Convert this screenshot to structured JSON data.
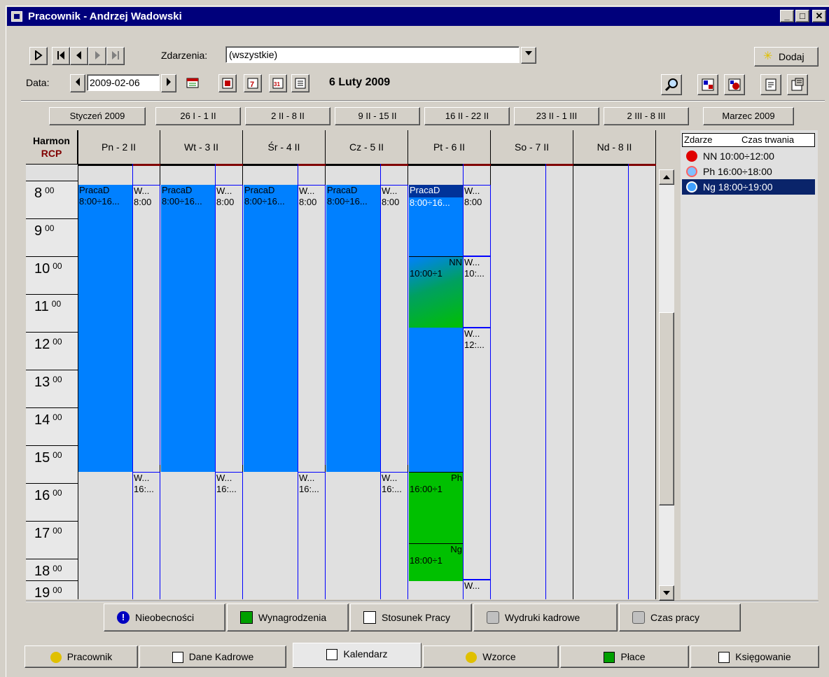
{
  "window": {
    "title": "Pracownik - Andrzej Wadowski"
  },
  "toolbar": {
    "events_label": "Zdarzenia:",
    "events_value": "(wszystkie)",
    "add_button": "Dodaj",
    "date_label": "Data:",
    "date_value": "2009-02-06",
    "date_display": "6 Luty 2009"
  },
  "week_nav": [
    "Styczeń 2009",
    "26 I - 1 II",
    "2 II - 8 II",
    "9 II - 15 II",
    "16 II - 22 II",
    "23 II - 1 III",
    "2 III - 8 III",
    "Marzec 2009"
  ],
  "grid": {
    "header_top": "Harmon",
    "header_bottom": "RCP",
    "days": [
      "Pn - 2 II",
      "Wt - 3 II",
      "Śr - 4 II",
      "Cz - 5 II",
      "Pt - 6 II",
      "So - 7 II",
      "Nd - 8 II"
    ],
    "hours": [
      "8",
      "9",
      "10",
      "11",
      "12",
      "13",
      "14",
      "15",
      "16",
      "17",
      "18",
      "19"
    ],
    "minutes": "00"
  },
  "events": {
    "praca_name": "PracaD",
    "praca_time": "8:00÷16...",
    "w_short": "W...",
    "w_time_8": "8:00",
    "w_time_16": "16:...",
    "w_time_10": "10:...",
    "w_time_12": "12:...",
    "nn_name": "NN",
    "nn_time": "10:00÷1",
    "ph_name": "Ph",
    "ph_time": "16:00÷1",
    "ng_name": "Ng",
    "ng_time": "18:00÷1"
  },
  "legend": {
    "col1": "Zdarze",
    "col2": "Czas trwania",
    "rows": [
      {
        "label": "NN  10:00÷12:00",
        "color": "#e00000"
      },
      {
        "label": "Ph  16:00÷18:00",
        "color": "#ff8080"
      },
      {
        "label": "Ng  18:00÷19:00",
        "color": "#40a0ff"
      }
    ]
  },
  "bottom_buttons": [
    "Nieobecności",
    "Wynagrodzenia",
    "Stosunek Pracy",
    "Wydruki kadrowe",
    "Czas pracy"
  ],
  "tabs": [
    "Pracownik",
    "Dane Kadrowe",
    "Kalendarz",
    "Wzorce",
    "Płace",
    "Księgowanie"
  ]
}
